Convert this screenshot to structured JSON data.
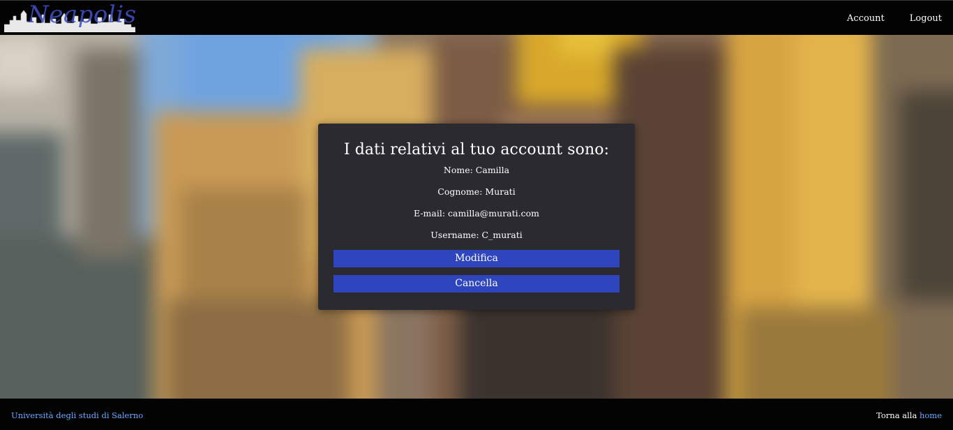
{
  "header": {
    "logo_text": "Neapolis",
    "nav": {
      "account_label": "Account",
      "logout_label": "Logout"
    }
  },
  "account": {
    "title": "I dati relativi al tuo account sono:",
    "fields": [
      {
        "label": "Nome:",
        "value": "Camilla"
      },
      {
        "label": "Cognome:",
        "value": "Murati"
      },
      {
        "label": "E-mail:",
        "value": "camilla@murati.com"
      },
      {
        "label": "Username:",
        "value": "C_murati"
      }
    ],
    "buttons": {
      "edit_label": "Modifica",
      "delete_label": "Cancella"
    }
  },
  "footer": {
    "university_link": "Università degli studi di Salerno",
    "back_text": "Torna alla",
    "home_link": "home"
  },
  "colors": {
    "header_bg": "#030303",
    "card_bg": "#2b2a30",
    "button_bg": "#2e45bd",
    "link_color": "#6fa8ff"
  }
}
